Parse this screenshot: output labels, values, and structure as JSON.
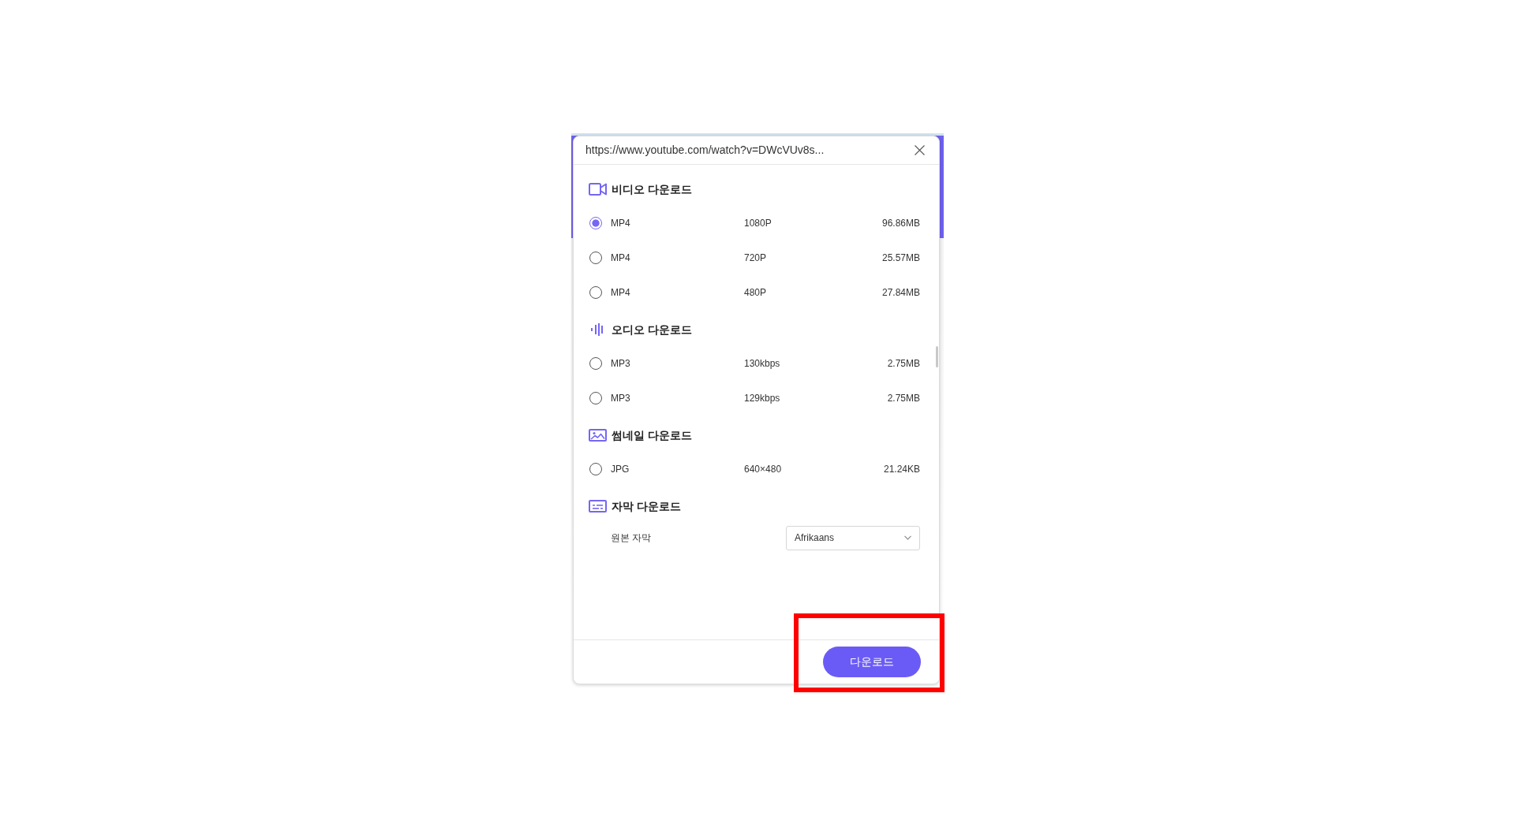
{
  "dialog": {
    "url": "https://www.youtube.com/watch?v=DWcVUv8s..."
  },
  "sections": [
    {
      "kind": "video",
      "title": "비디오 다운로드",
      "options": [
        {
          "format": "MP4",
          "quality": "1080P",
          "size": "96.86MB",
          "selected": true
        },
        {
          "format": "MP4",
          "quality": "720P",
          "size": "25.57MB",
          "selected": false
        },
        {
          "format": "MP4",
          "quality": "480P",
          "size": "27.84MB",
          "selected": false
        }
      ]
    },
    {
      "kind": "audio",
      "title": "오디오 다운로드",
      "options": [
        {
          "format": "MP3",
          "quality": "130kbps",
          "size": "2.75MB",
          "selected": false
        },
        {
          "format": "MP3",
          "quality": "129kbps",
          "size": "2.75MB",
          "selected": false
        }
      ]
    },
    {
      "kind": "image",
      "title": "썸네일 다운로드",
      "options": [
        {
          "format": "JPG",
          "quality": "640×480",
          "size": "21.24KB",
          "selected": false
        }
      ]
    },
    {
      "kind": "subtitle",
      "title": "자막 다운로드",
      "fields": [
        {
          "label": "원본 자막",
          "value": "Afrikaans"
        }
      ]
    }
  ],
  "download_button": {
    "label": "다운로드",
    "highlighted": true
  }
}
